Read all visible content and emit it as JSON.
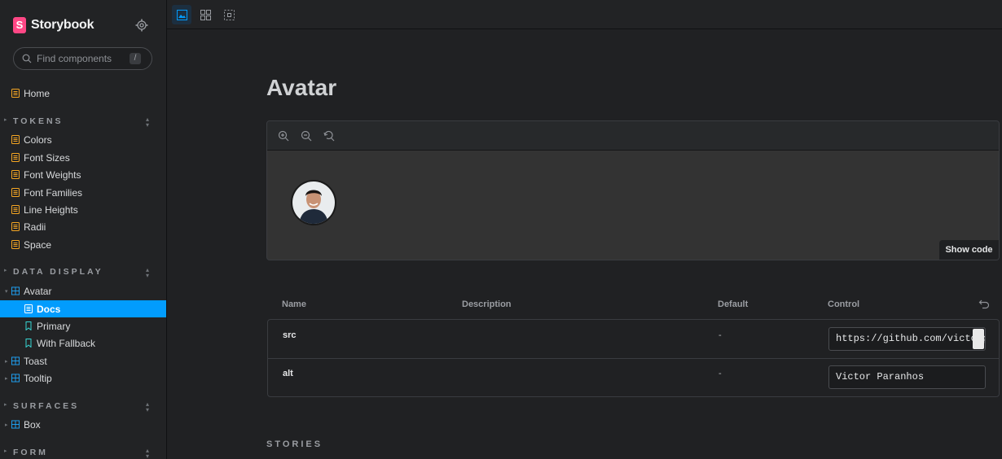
{
  "app": {
    "name": "Storybook",
    "logo_letter": "S",
    "accent": "#ff4785",
    "selection": "#029cfd"
  },
  "search": {
    "placeholder": "Find components",
    "shortcut": "/"
  },
  "sidebar": {
    "home": "Home",
    "sections": [
      {
        "title": "TOKENS",
        "items": [
          "Colors",
          "Font Sizes",
          "Font Weights",
          "Font Families",
          "Line Heights",
          "Radii",
          "Space"
        ]
      },
      {
        "title": "DATA DISPLAY",
        "items": [
          "Avatar",
          "Docs",
          "Primary",
          "With Fallback",
          "Toast",
          "Tooltip"
        ]
      },
      {
        "title": "SURFACES",
        "items": [
          "Box"
        ]
      },
      {
        "title": "FORM",
        "items": []
      }
    ]
  },
  "toolbar": {
    "buttons": [
      "image-icon",
      "grid-icon",
      "outline-icon"
    ]
  },
  "doc": {
    "title": "Avatar",
    "show_code": "Show code",
    "table": {
      "headers": [
        "Name",
        "Description",
        "Default",
        "Control"
      ],
      "rows": [
        {
          "name": "src",
          "default": "-",
          "value": "https://github.com/victorparanhos.png"
        },
        {
          "name": "alt",
          "default": "-",
          "value": "Victor Paranhos"
        }
      ]
    },
    "stories_heading": "STORIES"
  }
}
